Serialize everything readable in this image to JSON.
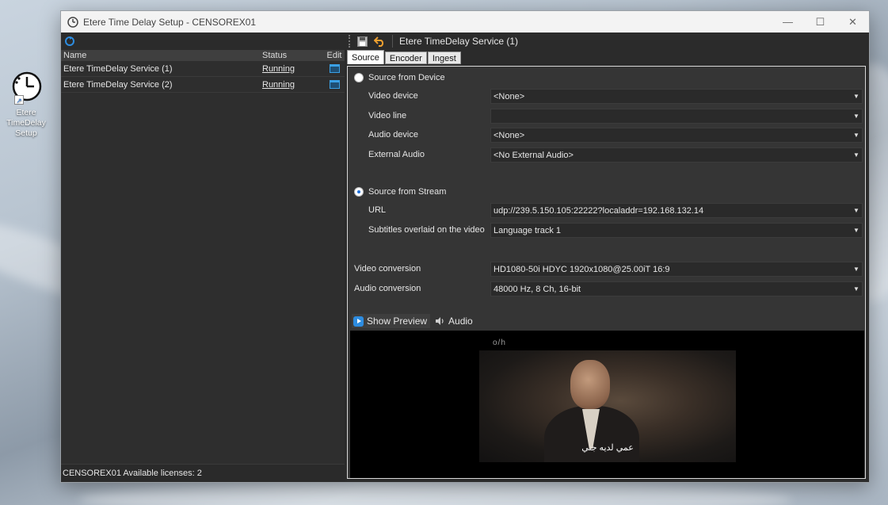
{
  "desktop_icon": {
    "label_line1": "Etere",
    "label_line2": "TimeDelay",
    "label_line3": "Setup"
  },
  "window": {
    "title": "Etere Time Delay Setup - CENSOREX01",
    "controls": {
      "minimize": "—",
      "maximize": "☐",
      "close": "✕"
    }
  },
  "services": {
    "columns": {
      "name": "Name",
      "status": "Status",
      "edit": "Edit"
    },
    "rows": [
      {
        "name": "Etere TimeDelay Service (1)",
        "status": "Running"
      },
      {
        "name": "Etere TimeDelay Service (2)",
        "status": "Running"
      }
    ]
  },
  "statusbar": {
    "text": "CENSOREX01  Available licenses: 2"
  },
  "editor": {
    "title": "Etere TimeDelay Service (1)",
    "tabs": [
      "Source",
      "Encoder",
      "Ingest"
    ],
    "source_from_device": {
      "label": "Source from Device",
      "video_device_label": "Video device",
      "video_device_value": "<None>",
      "video_line_label": "Video line",
      "video_line_value": "",
      "audio_device_label": "Audio device",
      "audio_device_value": "<None>",
      "external_audio_label": "External Audio",
      "external_audio_value": "<No External Audio>"
    },
    "source_from_stream": {
      "label": "Source from Stream",
      "url_label": "URL",
      "url_value": "udp://239.5.150.105:22222?localaddr=192.168.132.14",
      "subtitles_label": "Subtitles overlaid on the video",
      "subtitles_value": "Language track 1"
    },
    "video_conversion_label": "Video conversion",
    "video_conversion_value": "HD1080-50i HDYC 1920x1080@25.00iT 16:9",
    "audio_conversion_label": "Audio conversion",
    "audio_conversion_value": "48000 Hz, 8 Ch, 16-bit",
    "show_preview_label": "Show Preview",
    "audio_label": "Audio",
    "preview": {
      "logo_text": "o/h",
      "subtitle_text": "عمي لديه جني"
    }
  }
}
